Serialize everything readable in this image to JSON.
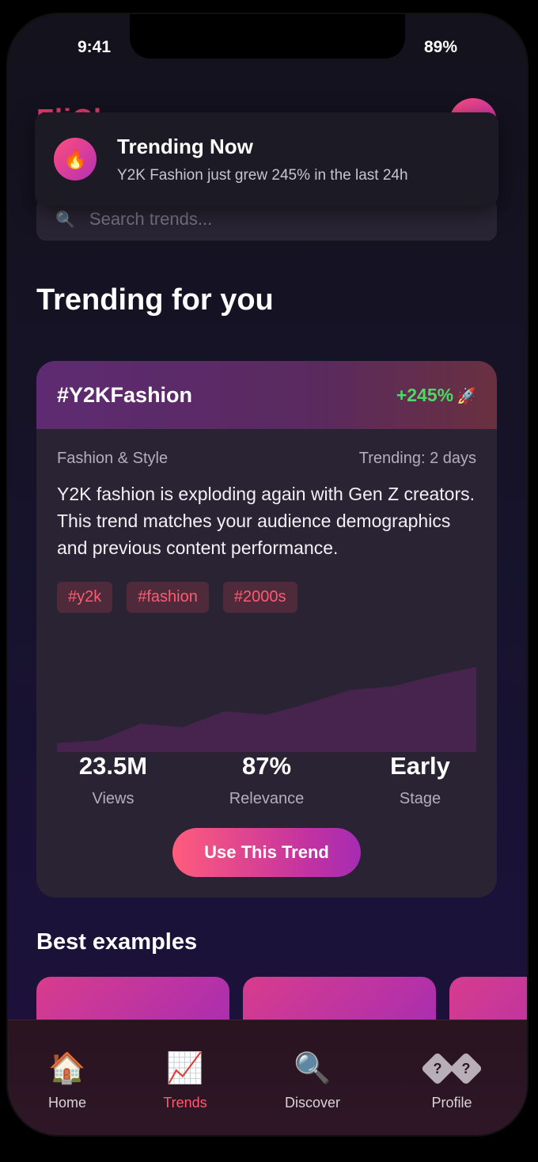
{
  "status": {
    "time": "9:41",
    "battery": "89%"
  },
  "header": {
    "logo": "FliCk"
  },
  "search": {
    "placeholder": "Search trends..."
  },
  "toast": {
    "icon": "fire-icon",
    "emoji": "🔥",
    "title": "Trending Now",
    "subtitle": "Y2K Fashion just grew 245% in the last 24h"
  },
  "main": {
    "section_title": "Trending for you"
  },
  "trend": {
    "hashtag": "#Y2KFashion",
    "growth": "+245%",
    "growth_emoji": "🚀",
    "category": "Fashion & Style",
    "trending_for": "Trending: 2 days",
    "description": "Y2K fashion is exploding again with Gen Z creators. This trend matches your audience demographics and previous content performance.",
    "tags": [
      "#y2k",
      "#fashion",
      "#2000s"
    ],
    "stats": [
      {
        "value": "23.5M",
        "label": "Views"
      },
      {
        "value": "87%",
        "label": "Relevance"
      },
      {
        "value": "Early",
        "label": "Stage"
      }
    ],
    "cta_label": "Use This Trend"
  },
  "chart_data": {
    "type": "area",
    "x": [
      0,
      1,
      2,
      3,
      4,
      5,
      6,
      7,
      8,
      9,
      10
    ],
    "values": [
      10,
      13,
      32,
      28,
      46,
      42,
      55,
      70,
      74,
      86,
      96
    ],
    "ylim": [
      0,
      100
    ],
    "title": "",
    "xlabel": "",
    "ylabel": ""
  },
  "best": {
    "title": "Best examples",
    "count": 3
  },
  "tabs": [
    {
      "label": "Home",
      "icon": "house-icon",
      "emoji": "🏠",
      "active": false
    },
    {
      "label": "Trends",
      "icon": "chart-increasing-icon",
      "emoji": "📈",
      "active": true
    },
    {
      "label": "Discover",
      "icon": "magnifier-icon",
      "emoji": "🔍",
      "active": false
    },
    {
      "label": "Profile",
      "icon": "question-icon",
      "emoji": "?",
      "active": false
    }
  ],
  "colors": {
    "accent": "#ff5a73",
    "growth": "#4cd964",
    "chart_fill": "#4a2550"
  }
}
